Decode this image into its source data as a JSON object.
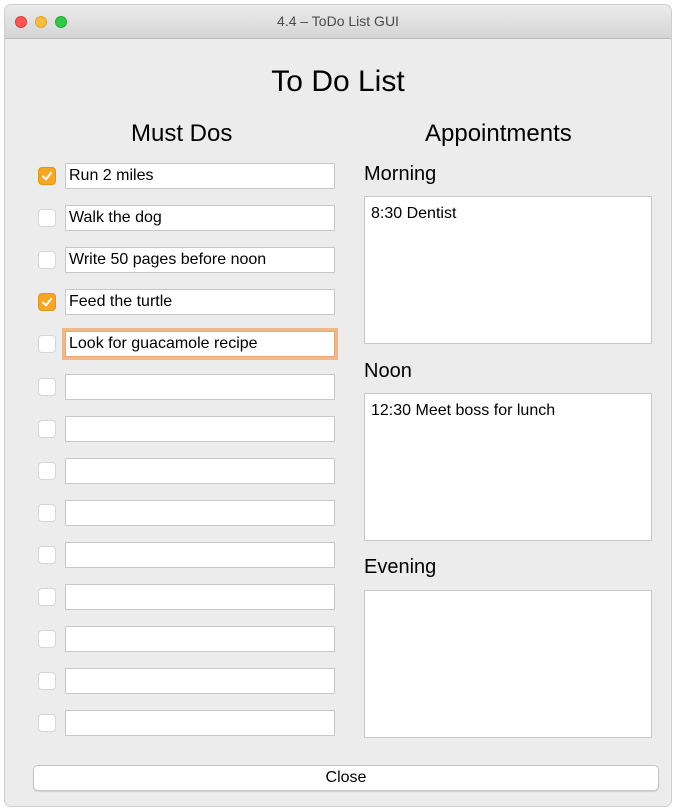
{
  "window": {
    "title": "4.4 – ToDo List GUI"
  },
  "app_title": "To Do List",
  "must_dos": {
    "heading": "Must Dos",
    "items": [
      {
        "text": "Run 2 miles",
        "checked": true
      },
      {
        "text": "Walk the dog",
        "checked": false
      },
      {
        "text": "Write 50 pages before noon",
        "checked": false
      },
      {
        "text": "Feed the turtle",
        "checked": true
      },
      {
        "text": "Look for guacamole recipe",
        "checked": false,
        "focused": true
      },
      {
        "text": "",
        "checked": false
      },
      {
        "text": "",
        "checked": false
      },
      {
        "text": "",
        "checked": false
      },
      {
        "text": "",
        "checked": false
      },
      {
        "text": "",
        "checked": false
      },
      {
        "text": "",
        "checked": false
      },
      {
        "text": "",
        "checked": false
      },
      {
        "text": "",
        "checked": false
      },
      {
        "text": "",
        "checked": false
      }
    ]
  },
  "appointments": {
    "heading": "Appointments",
    "morning": {
      "label": "Morning",
      "text": "8:30 Dentist"
    },
    "noon": {
      "label": "Noon",
      "text": "12:30 Meet boss for lunch"
    },
    "evening": {
      "label": "Evening",
      "text": ""
    }
  },
  "close_button": {
    "label": "Close"
  },
  "colors": {
    "accent": "#f5a623",
    "focus_ring": "#f1b98a"
  }
}
